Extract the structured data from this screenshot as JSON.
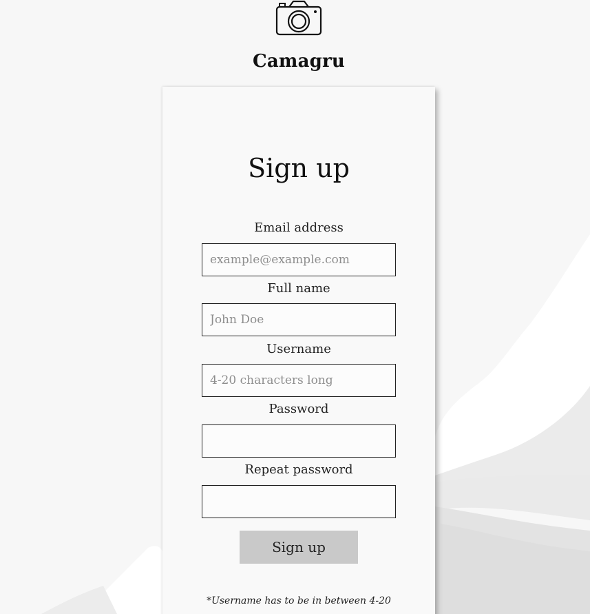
{
  "header": {
    "logo_icon": "camera-icon",
    "title": "Camagru"
  },
  "form": {
    "heading": "Sign up",
    "fields": [
      {
        "label": "Email address",
        "placeholder": "example@example.com",
        "value": "",
        "type": "email"
      },
      {
        "label": "Full name",
        "placeholder": "John Doe",
        "value": "",
        "type": "text"
      },
      {
        "label": "Username",
        "placeholder": "4-20 characters long",
        "value": "",
        "type": "text"
      },
      {
        "label": "Password",
        "placeholder": "",
        "value": "",
        "type": "password"
      },
      {
        "label": "Repeat password",
        "placeholder": "",
        "value": "",
        "type": "password"
      }
    ],
    "submit_label": "Sign up",
    "footnote": "*Username has to be in between 4-20"
  },
  "colors": {
    "background": "#f7f7f7",
    "card": "#f9f9f9",
    "button": "#c9c9c9",
    "text": "#1a1a1a"
  }
}
